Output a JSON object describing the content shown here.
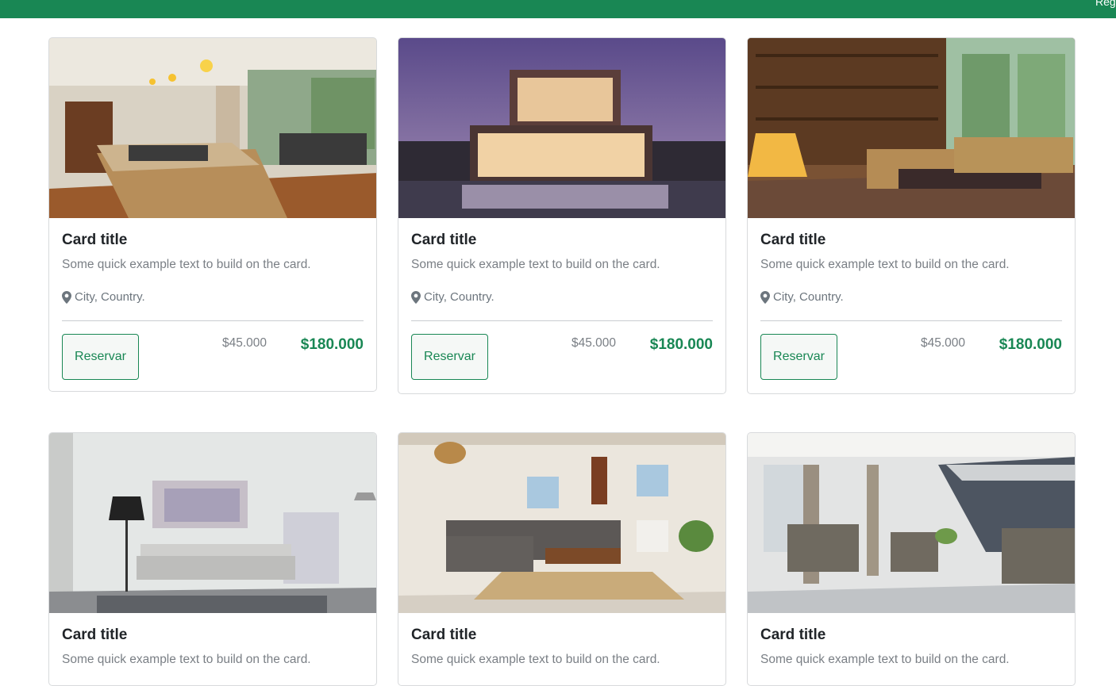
{
  "topbar": {
    "edge_text": "Reg"
  },
  "accent_color": "#198754",
  "cards": [
    {
      "title": "Card title",
      "text": "Some quick example text to build on the card.",
      "location": "City, Country.",
      "button_label": "Reservar",
      "old_price": "$45.000",
      "price": "$180.000",
      "image": "kitchen-interior"
    },
    {
      "title": "Card title",
      "text": "Some quick example text to build on the card.",
      "location": "City, Country.",
      "button_label": "Reservar",
      "old_price": "$45.000",
      "price": "$180.000",
      "image": "modern-house-dusk"
    },
    {
      "title": "Card title",
      "text": "Some quick example text to build on the card.",
      "location": "City, Country.",
      "button_label": "Reservar",
      "old_price": "$45.000",
      "price": "$180.000",
      "image": "library-living-room"
    },
    {
      "title": "Card title",
      "text": "Some quick example text to build on the card.",
      "image": "white-living-room"
    },
    {
      "title": "Card title",
      "text": "Some quick example text to build on the card.",
      "image": "rustic-living-room"
    },
    {
      "title": "Card title",
      "text": "Some quick example text to build on the card.",
      "image": "staircase-lounge"
    }
  ]
}
